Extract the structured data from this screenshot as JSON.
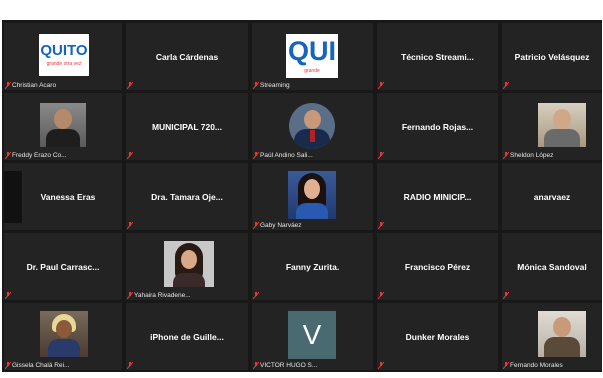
{
  "colors": {
    "background": "#181818",
    "tile": "#232323",
    "mic_muted": "#e53935",
    "avatar_v": "#4a6a72"
  },
  "icons": {
    "muted_mic": "muted-mic-icon"
  },
  "tiles": [
    {
      "kind": "logo",
      "logo_text": "QUITO",
      "logo_sub": "grande otra vez",
      "label": "Christian Acaro"
    },
    {
      "kind": "name",
      "name": "Carla Cárdenas"
    },
    {
      "kind": "logo",
      "logo_text": "QUI",
      "logo_sub": "grande",
      "label": "Streaming"
    },
    {
      "kind": "name",
      "name": "Técnico Streami..."
    },
    {
      "kind": "name",
      "name": "Patricio Velásquez"
    },
    {
      "kind": "photo",
      "label": "Freddy Erazo Co..."
    },
    {
      "kind": "name",
      "name": "MUNICIPAL 720..."
    },
    {
      "kind": "photo",
      "label": "Paúl Andino Sali..."
    },
    {
      "kind": "name",
      "name": "Fernando Rojas..."
    },
    {
      "kind": "photo",
      "label": "Sheldon López"
    },
    {
      "kind": "name",
      "name": "Vanessa Eras"
    },
    {
      "kind": "name",
      "name": "Dra. Tamara Oje..."
    },
    {
      "kind": "photo",
      "label": "Gaby Narváez"
    },
    {
      "kind": "name",
      "name": "RADIO MINICIP..."
    },
    {
      "kind": "name",
      "name": "anarvaez"
    },
    {
      "kind": "name",
      "name": "Dr. Paul Carrasc..."
    },
    {
      "kind": "photo",
      "label": "Yahaira Rivadene..."
    },
    {
      "kind": "name",
      "name": "Fanny Zurita."
    },
    {
      "kind": "name",
      "name": "Francisco Pérez"
    },
    {
      "kind": "name",
      "name": "Mónica Sandoval"
    },
    {
      "kind": "photo",
      "label": "Gissela Chalá Rei..."
    },
    {
      "kind": "name",
      "name": "iPhone de Guille..."
    },
    {
      "kind": "avatar",
      "initial": "V",
      "label": "VICTOR HUGO S..."
    },
    {
      "kind": "name",
      "name": "Dunker Morales"
    },
    {
      "kind": "photo",
      "label": "Fernando Morales"
    }
  ]
}
